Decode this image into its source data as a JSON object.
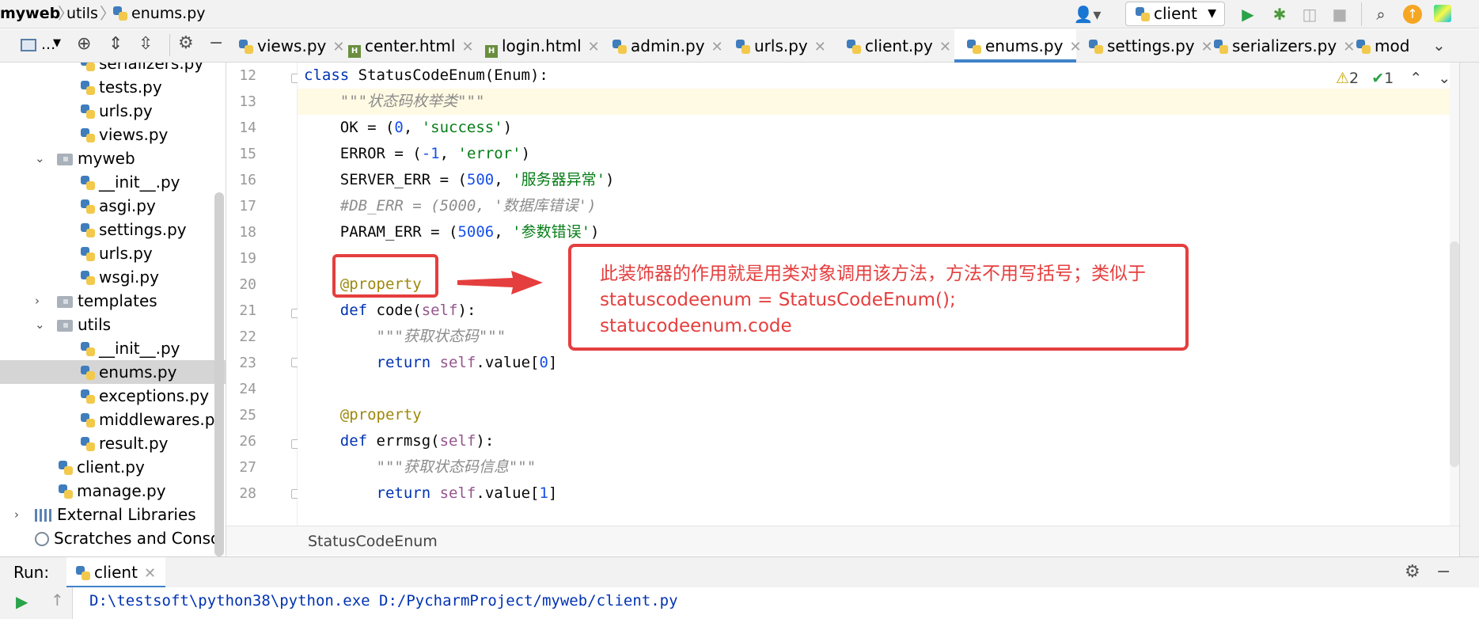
{
  "breadcrumb": [
    "myweb",
    "utils",
    "enums.py"
  ],
  "run_config": {
    "label": "client"
  },
  "tabs": [
    {
      "label": "views.py",
      "icon": "python-file-icon"
    },
    {
      "label": "center.html",
      "icon": "html-file-icon"
    },
    {
      "label": "login.html",
      "icon": "html-file-icon"
    },
    {
      "label": "admin.py",
      "icon": "python-file-icon"
    },
    {
      "label": "urls.py",
      "icon": "python-file-icon"
    },
    {
      "label": "client.py",
      "icon": "python-file-icon"
    },
    {
      "label": "enums.py",
      "icon": "python-file-icon",
      "active": true
    },
    {
      "label": "settings.py",
      "icon": "python-file-icon"
    },
    {
      "label": "serializers.py",
      "icon": "python-file-icon"
    },
    {
      "label": "mod",
      "icon": "python-file-icon"
    }
  ],
  "sidebar_toolbar": {
    "view_label": "..."
  },
  "tree": [
    {
      "label": "serializers.py",
      "type": "py"
    },
    {
      "label": "tests.py",
      "type": "py"
    },
    {
      "label": "urls.py",
      "type": "py"
    },
    {
      "label": "views.py",
      "type": "py"
    },
    {
      "label": "myweb",
      "type": "folder",
      "expanded": true
    },
    {
      "label": "__init__.py",
      "type": "py"
    },
    {
      "label": "asgi.py",
      "type": "py"
    },
    {
      "label": "settings.py",
      "type": "py"
    },
    {
      "label": "urls.py",
      "type": "py"
    },
    {
      "label": "wsgi.py",
      "type": "py"
    },
    {
      "label": "templates",
      "type": "folder",
      "expanded": false
    },
    {
      "label": "utils",
      "type": "folder",
      "expanded": true
    },
    {
      "label": "__init__.py",
      "type": "py"
    },
    {
      "label": "enums.py",
      "type": "py",
      "selected": true
    },
    {
      "label": "exceptions.py",
      "type": "py"
    },
    {
      "label": "middlewares.py",
      "type": "py"
    },
    {
      "label": "result.py",
      "type": "py"
    },
    {
      "label": "client.py",
      "type": "py"
    },
    {
      "label": "manage.py",
      "type": "py"
    },
    {
      "label": "External Libraries",
      "type": "lib",
      "expanded": false
    },
    {
      "label": "Scratches and Console",
      "type": "scratch"
    }
  ],
  "editor": {
    "line_numbers": [
      "12",
      "13",
      "14",
      "15",
      "16",
      "17",
      "18",
      "19",
      "20",
      "21",
      "22",
      "23",
      "24",
      "25",
      "26",
      "27",
      "28"
    ],
    "code_lines": [
      "class StatusCodeEnum(Enum):",
      "    \"\"\"状态码枚举类\"\"\"",
      "    OK = (0, 'success')",
      "    ERROR = (-1, 'error')",
      "    SERVER_ERR = (500, '服务器异常')",
      "    #DB_ERR = (5000, '数据库错误')",
      "    PARAM_ERR = (5006, '参数错误')",
      "",
      "    @property",
      "    def code(self):",
      "        \"\"\"获取状态码\"\"\"",
      "        return self.value[0]",
      "",
      "    @property",
      "    def errmsg(self):",
      "        \"\"\"获取状态码信息\"\"\"",
      "        return self.value[1]"
    ],
    "inspection": {
      "warnings": "2",
      "ok": "1"
    },
    "sticky_header": "StatusCodeEnum"
  },
  "annotation": {
    "lines": [
      "此装饰器的作用就是用类对象调用该方法，方法不用写括号；类似于",
      "statuscodeenum = StatusCodeEnum();",
      "statucodeenum.code"
    ],
    "color": "#e53e3e"
  },
  "run_panel": {
    "title": "Run:",
    "tab_label": "client",
    "console_line": "D:\\testsoft\\python38\\python.exe D:/PycharmProject/myweb/client.py"
  }
}
